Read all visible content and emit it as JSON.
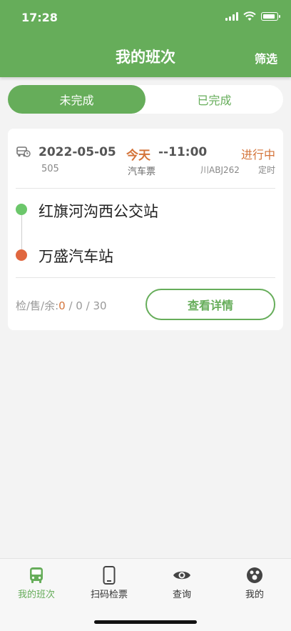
{
  "status_bar": {
    "time": "17:28"
  },
  "header": {
    "title": "我的班次",
    "filter_label": "筛选"
  },
  "segments": {
    "active": "未完成",
    "inactive": "已完成"
  },
  "trip": {
    "date": "2022-05-05",
    "day": "今天",
    "departure": "--11:00",
    "status": "进行中",
    "route_no": "505",
    "ticket_type": "汽车票",
    "plate": "川ABJ262",
    "schedule_type": "定时",
    "from_station": "红旗河沟西公交站",
    "to_station": "万盛汽车站",
    "stats_label": "检/售/余:",
    "checked": "0",
    "sold": " / 0 / 30",
    "detail_button": "查看详情"
  },
  "tabbar": {
    "items": [
      {
        "label": "我的班次",
        "icon": "bus-icon"
      },
      {
        "label": "扫码检票",
        "icon": "phone-icon"
      },
      {
        "label": "查询",
        "icon": "eye-icon"
      },
      {
        "label": "我的",
        "icon": "user-icon"
      }
    ]
  },
  "colors": {
    "primary": "#66ad5a",
    "accent": "#d4743a",
    "start_dot": "#6cc76b",
    "end_dot": "#e0673f"
  }
}
